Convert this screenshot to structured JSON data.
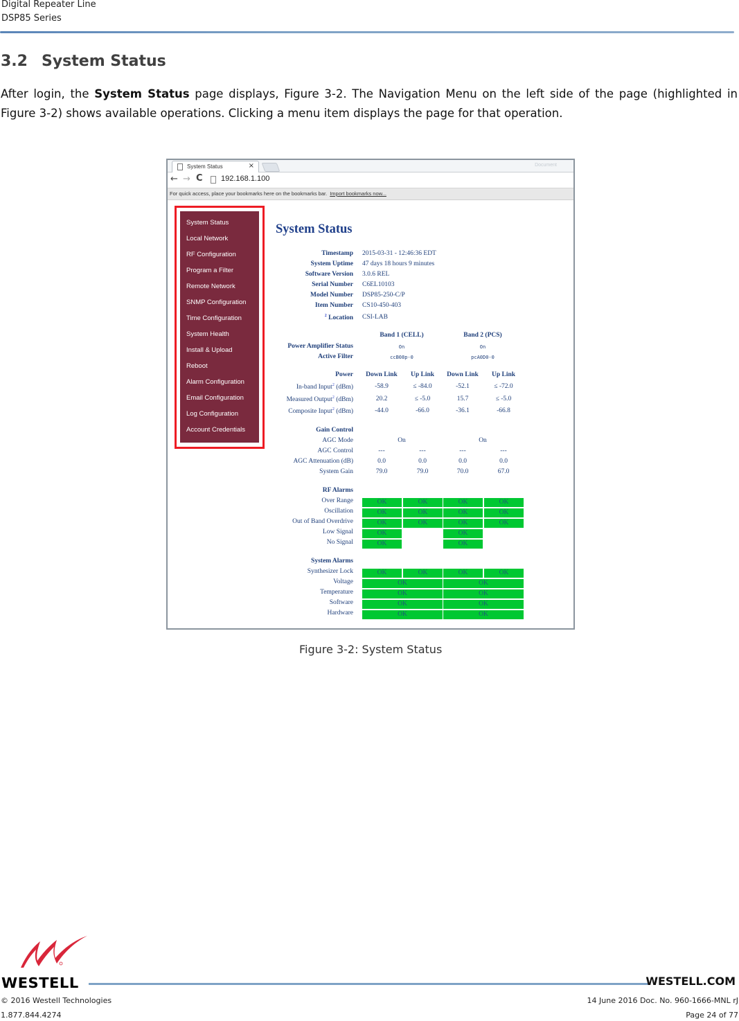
{
  "header": {
    "line1": "Digital Repeater Line",
    "line2": "DSP85 Series"
  },
  "section": {
    "number": "3.2",
    "title": "System Status",
    "para_before_bold": "After login, the ",
    "para_bold": "System Status",
    "para_after_bold": " page displays, Figure 3-2.  The Navigation Menu on the left side of the page (highlighted in Figure 3-2) shows available operations.  Clicking a menu item displays the page for that operation."
  },
  "browser": {
    "tab_title": "System Status",
    "tab_close": "×",
    "window_label": "Document",
    "url": "192.168.1.100",
    "bookmarks_text": "For quick access, place your bookmarks here on the bookmarks bar.",
    "bookmarks_link": "Import bookmarks now...",
    "icons": {
      "back": "←",
      "forward": "→",
      "reload": "C"
    }
  },
  "sidebar": {
    "items": [
      "System Status",
      "Local Network",
      "RF Configuration",
      "Program a Filter",
      "Remote Network",
      "SNMP Configuration",
      "Time Configuration",
      "System Health",
      "Install & Upload",
      "Reboot",
      "Alarm Configuration",
      "Email Configuration",
      "Log Configuration",
      "Account Credentials"
    ],
    "background_color": "#7a2a3e",
    "highlight_color": "#ee1c24"
  },
  "status_page": {
    "title": "System Status",
    "info": [
      {
        "label": "Timestamp",
        "value": "2015-03-31 - 12:46:36 EDT"
      },
      {
        "label": "System Uptime",
        "value": "47 days 18 hours 9 minutes"
      },
      {
        "label": "Software Version",
        "value": "3.0.6 REL"
      },
      {
        "label": "Serial Number",
        "value": "C6EL10103"
      },
      {
        "label": "Model Number",
        "value": "DSP85-250-C/P"
      },
      {
        "label": "Item Number",
        "value": "CS10-450-403"
      },
      {
        "label": "Location",
        "value": "CSI-LAB",
        "footnote": "2"
      }
    ],
    "bands": {
      "band1": "Band 1 (CELL)",
      "band2": "Band 2 (PCS)",
      "pa_status_label": "Power Amplifier Status",
      "pa_status": [
        "On",
        "On"
      ],
      "active_filter_label": "Active Filter",
      "active_filter": [
        "ccB08p-0",
        "pcA0D0-0"
      ]
    },
    "power": {
      "label": "Power",
      "columns": [
        "Down Link",
        "Up Link",
        "Down Link",
        "Up Link"
      ],
      "rows": [
        {
          "label": "In-band Input",
          "footnote": "2",
          "unit": "(dBm)",
          "values": [
            "-58.9",
            "≤ -84.0",
            "-52.1",
            "≤ -72.0"
          ]
        },
        {
          "label": "Measured Output",
          "footnote": "2",
          "unit": "(dBm)",
          "values": [
            "20.2",
            "≤ -5.0",
            "15.7",
            "≤ -5.0"
          ]
        },
        {
          "label": "Composite Input",
          "footnote": "2",
          "unit": "(dBm)",
          "values": [
            "-44.0",
            "-66.0",
            "-36.1",
            "-66.8"
          ]
        }
      ]
    },
    "gain_control": {
      "label": "Gain Control",
      "agc_mode_label": "AGC Mode",
      "agc_mode": [
        "On",
        "On"
      ],
      "rows": [
        {
          "label": "AGC Control",
          "values": [
            "---",
            "---",
            "---",
            "---"
          ]
        },
        {
          "label": "AGC Attenuation (dB)",
          "values": [
            "0.0",
            "0.0",
            "0.0",
            "0.0"
          ]
        },
        {
          "label": "System Gain",
          "values": [
            "79.0",
            "79.0",
            "70.0",
            "67.0"
          ]
        }
      ]
    },
    "rf_alarms": {
      "label": "RF Alarms",
      "rows": [
        {
          "label": "Over Range",
          "values": [
            "OK",
            "OK",
            "OK",
            "OK"
          ]
        },
        {
          "label": "Oscillation",
          "values": [
            "OK",
            "OK",
            "OK",
            "OK"
          ]
        },
        {
          "label": "Out of Band Overdrive",
          "values": [
            "OK",
            "OK",
            "OK",
            "OK"
          ]
        },
        {
          "label": "Low Signal",
          "values": [
            "OK",
            "",
            "OK",
            ""
          ]
        },
        {
          "label": "No Signal",
          "values": [
            "OK",
            "",
            "OK",
            ""
          ]
        }
      ]
    },
    "system_alarms": {
      "label": "System Alarms",
      "synth_lock": {
        "label": "Synthesizer Lock",
        "values": [
          "OK",
          "OK",
          "OK",
          "OK"
        ]
      },
      "rows": [
        {
          "label": "Voltage",
          "values": [
            "OK",
            "OK"
          ]
        },
        {
          "label": "Temperature",
          "values": [
            "OK",
            "OK"
          ]
        },
        {
          "label": "Software",
          "values": [
            "OK",
            "OK"
          ]
        },
        {
          "label": "Hardware",
          "values": [
            "OK",
            "OK"
          ]
        }
      ]
    },
    "ok_color": "#00c832"
  },
  "caption": "Figure 3-2: System Status",
  "footer": {
    "logo_text": "WESTELL",
    "website": "WESTELL.COM",
    "copyright": "© 2016 Westell Technologies",
    "phone": "1.877.844.4274",
    "doc": "14 June 2016 Doc. No. 960-1666-MNL rJ",
    "page": "Page 24 of 77"
  }
}
